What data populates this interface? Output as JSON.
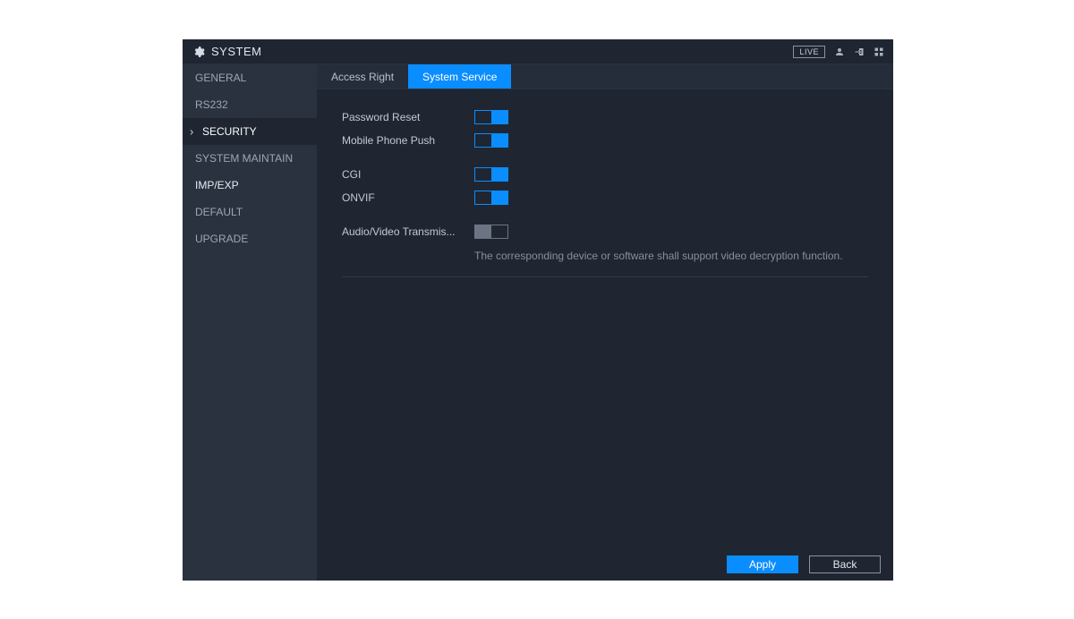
{
  "title": "SYSTEM",
  "header": {
    "live": "LIVE"
  },
  "sidebar": {
    "items": [
      {
        "label": "GENERAL"
      },
      {
        "label": "RS232"
      },
      {
        "label": "SECURITY"
      },
      {
        "label": "SYSTEM MAINTAIN"
      },
      {
        "label": "IMP/EXP"
      },
      {
        "label": "DEFAULT"
      },
      {
        "label": "UPGRADE"
      }
    ]
  },
  "tabs": {
    "access_right": "Access Right",
    "system_service": "System Service"
  },
  "settings": {
    "password_reset": {
      "label": "Password Reset",
      "on": true
    },
    "mobile_push": {
      "label": "Mobile Phone Push",
      "on": true
    },
    "cgi": {
      "label": "CGI",
      "on": true
    },
    "onvif": {
      "label": "ONVIF",
      "on": true
    },
    "av_transmis": {
      "label": "Audio/Video Transmis...",
      "on": false,
      "hint": "The corresponding device or software shall support video decryption function."
    }
  },
  "footer": {
    "apply": "Apply",
    "back": "Back"
  }
}
